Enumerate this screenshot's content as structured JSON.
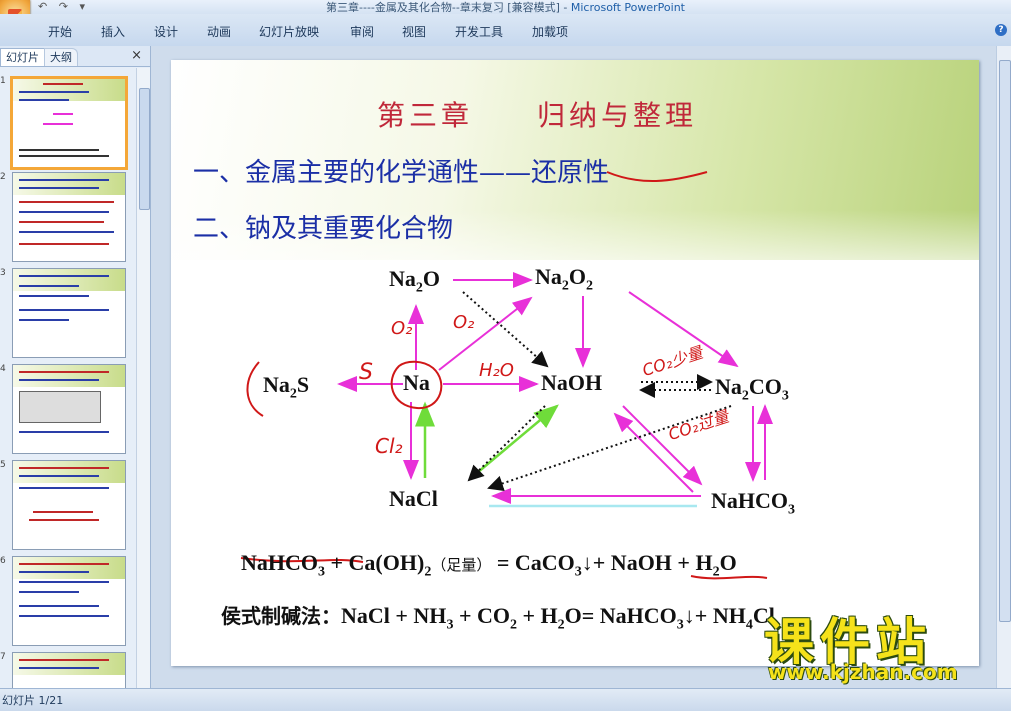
{
  "window": {
    "title": "第三章----金属及其化合物--章末复习 [兼容模式] - ",
    "app_name": "Microsoft PowerPoint"
  },
  "qat": {
    "undo": "↶",
    "redo": "↷",
    "more": "▾"
  },
  "ribbon": {
    "tabs": [
      "开始",
      "插入",
      "设计",
      "动画",
      "幻灯片放映",
      "审阅",
      "视图",
      "开发工具",
      "加载项"
    ],
    "help": "?"
  },
  "left_panel": {
    "tab_slides": "幻灯片",
    "tab_outline": "大纲",
    "close": "×",
    "thumbnails": [
      {
        "num": "1",
        "selected": true
      },
      {
        "num": "2",
        "selected": false
      },
      {
        "num": "3",
        "selected": false
      },
      {
        "num": "4",
        "selected": false
      },
      {
        "num": "5",
        "selected": false
      },
      {
        "num": "6",
        "selected": false
      },
      {
        "num": "7",
        "selected": false
      }
    ]
  },
  "slide": {
    "chapter_title": "第三章　　归纳与整理",
    "heading1_prefix": "一、金属主要的化学通性——",
    "heading1_key": "还原性",
    "heading2": "二、钠及其重要化合物",
    "nodes": {
      "na2o": {
        "base": "Na",
        "sub": "2",
        "tail": "O"
      },
      "na2o2_a": {
        "base": "Na",
        "sub": "2"
      },
      "na2o2_b": {
        "base": "O",
        "sub": "2"
      },
      "na2s": {
        "base": "Na",
        "sub": "2",
        "tail": "S"
      },
      "na": "Na",
      "naoh": "NaOH",
      "na2co3": {
        "base": "Na",
        "sub": "2",
        "mid": "CO",
        "sub2": "3"
      },
      "nacl": "NaCl",
      "nahco3": {
        "base": "NaHCO",
        "sub": "3"
      }
    },
    "annotations": {
      "o2_a": "O₂",
      "o2_b": "O₂",
      "s": "S",
      "h2o": "H₂O",
      "cl2": "Cl₂",
      "co2_a": "CO₂少量",
      "co2_b": "CO₂过量"
    },
    "equation1": {
      "p1": "NaHCO",
      "p1sub": "3",
      "p2": " + Ca(OH)",
      "p2sub": "2",
      "note": "（足量）",
      "p3": " = CaCO",
      "p3sub": "3",
      "p4": "↓+ NaOH + H",
      "p4sub": "2",
      "p5": "O"
    },
    "equation2": {
      "label": "侯式制碱法：",
      "p1": "NaCl + NH",
      "p1sub": "3",
      "p2": " + CO",
      "p2sub": "2",
      "p3": " + H",
      "p3sub": "2",
      "p4": "O= NaHCO",
      "p4sub": "3",
      "p5": "↓+ NH",
      "p5sub": "4",
      "p6": "Cl"
    }
  },
  "status_bar": {
    "slide_info": "幻灯片 1/21"
  },
  "watermark": {
    "title": "课件站",
    "url": "www.kjzhan.com"
  },
  "colors": {
    "accent_magenta": "#e830d8",
    "accent_green": "#6fdc3a",
    "accent_cyan": "#a8e8f0",
    "title_red": "#c0283a",
    "heading_blue": "#1b2fa6",
    "ink_red": "#d01818"
  }
}
